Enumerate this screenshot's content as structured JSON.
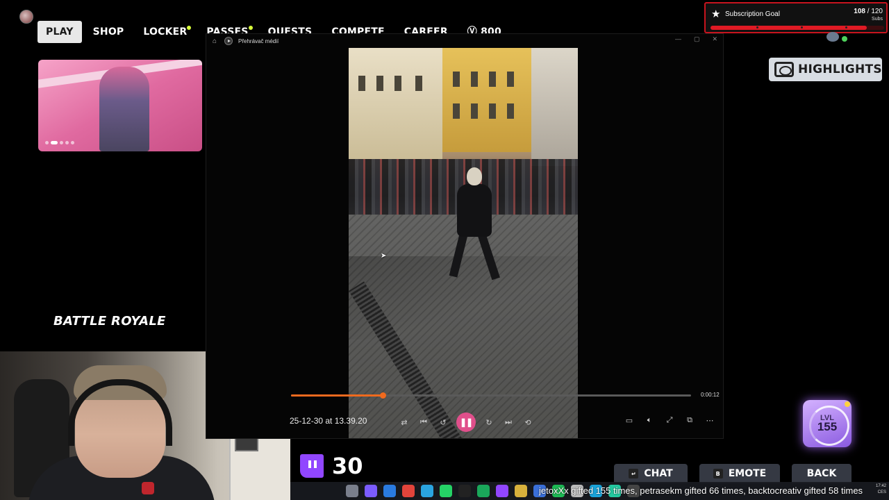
{
  "game_nav": {
    "items": [
      {
        "label": "PLAY",
        "active": true
      },
      {
        "label": "SHOP"
      },
      {
        "label": "LOCKER",
        "dot": true
      },
      {
        "label": "PASSES",
        "dot": true
      },
      {
        "label": "QUESTS"
      },
      {
        "label": "COMPETE"
      },
      {
        "label": "CAREER"
      },
      {
        "label": "800",
        "icon": "vbucks-icon"
      }
    ]
  },
  "promo": {
    "dots": 5,
    "active_dot": 1
  },
  "mode": {
    "label": "BATTLE ROYALE"
  },
  "player": {
    "title": "Přehrávač médií",
    "filename": "25-12-30 at 13.39.20",
    "time_total": "0:00:12",
    "progress": 0.23,
    "colors": {
      "accent": "#f06a1e",
      "play": "#e04f8b"
    }
  },
  "subscription_goal": {
    "title": "Subscription Goal",
    "current": "108",
    "goal": "120",
    "unit": "Subs",
    "current_value": 108,
    "goal_value": 120
  },
  "highlights": {
    "label": "HIGHLIGHTS"
  },
  "level": {
    "label": "LVL",
    "value": "155"
  },
  "twitch": {
    "count": "30"
  },
  "buttons": {
    "chat": {
      "key": "↵",
      "label": "CHAT"
    },
    "emote": {
      "key": "B",
      "label": "EMOTE"
    },
    "back": {
      "label": "BACK"
    }
  },
  "ticker": {
    "text": "jetoxXx gifted 155 times, petrasekm gifted 66 times, backtocreativ gifted 58 times"
  },
  "clock": {
    "time": "17:42",
    "lang": "CES"
  }
}
